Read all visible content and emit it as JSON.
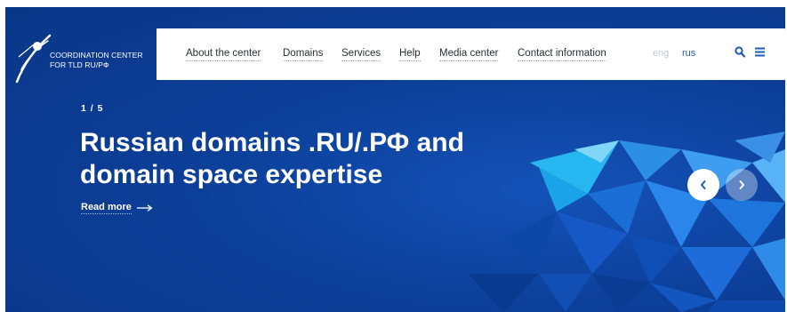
{
  "logo": {
    "line1": "COORDINATION CENTER",
    "line2": "FOR TLD RU/РФ",
    "icon": "satellite-logo-icon"
  },
  "nav": {
    "items": [
      "About the center",
      "Domains",
      "Services",
      "Help",
      "Media center",
      "Contact information"
    ],
    "languages": {
      "eng": "eng",
      "rus": "rus"
    },
    "icons": {
      "search": "search-icon",
      "menu": "hamburger-menu-icon"
    }
  },
  "slider": {
    "counter": "1 / 5",
    "current": 1,
    "total": 5,
    "headline_line1": "Russian domains .RU/.РФ and",
    "headline_line2": "domain space expertise",
    "read_more": "Read more",
    "prev_icon": "chevron-left-icon",
    "next_icon": "chevron-right-icon"
  },
  "colors": {
    "hero": "#0c3f99",
    "accent": "#1e5bb8",
    "nav_text": "#2b2f38"
  }
}
